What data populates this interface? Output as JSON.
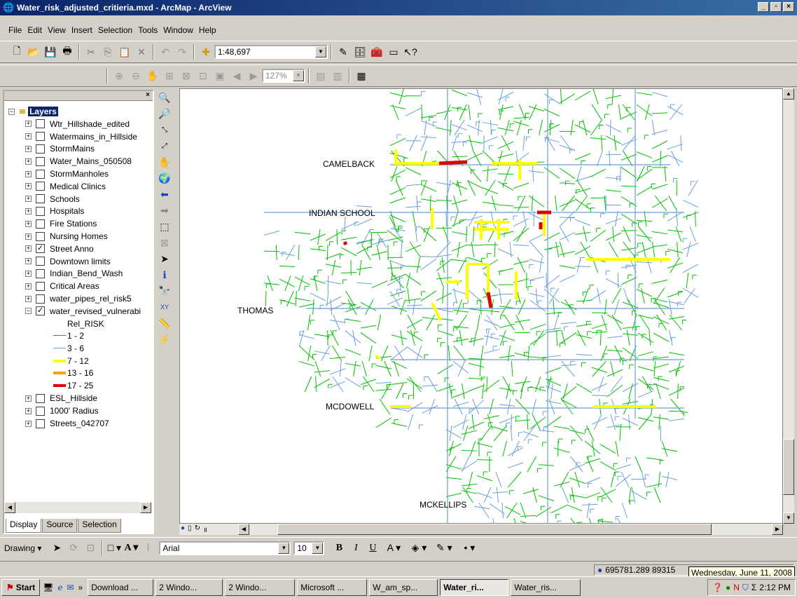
{
  "window": {
    "title": "Water_risk_adjusted_critieria.mxd - ArcMap - ArcView",
    "buttons": [
      "_",
      "▫",
      "×"
    ]
  },
  "menu": [
    "File",
    "Edit",
    "View",
    "Insert",
    "Selection",
    "Tools",
    "Window",
    "Help"
  ],
  "standard_toolbar": {
    "scale": "1:48,697"
  },
  "layout_toolbar": {
    "zoom": "127%"
  },
  "toc": {
    "root": "Layers",
    "layers": [
      {
        "name": "Wtr_Hillshade_edited",
        "checked": false
      },
      {
        "name": "Watermains_in_Hillside",
        "checked": false
      },
      {
        "name": "StormMains",
        "checked": false
      },
      {
        "name": "Water_Mains_050508",
        "checked": false
      },
      {
        "name": "StormManholes",
        "checked": false
      },
      {
        "name": "Medical Clinics",
        "checked": false
      },
      {
        "name": "Schools",
        "checked": false
      },
      {
        "name": "Hospitals",
        "checked": false
      },
      {
        "name": "Fire Stations",
        "checked": false
      },
      {
        "name": "Nursing Homes",
        "checked": false
      },
      {
        "name": "Street Anno",
        "checked": true
      },
      {
        "name": "Downtown limits",
        "checked": false
      },
      {
        "name": "Indian_Bend_Wash",
        "checked": false
      },
      {
        "name": "Critical Areas",
        "checked": false
      },
      {
        "name": "water_pipes_rel_risk5",
        "checked": false
      },
      {
        "name": "water_revised_vulnerabi",
        "checked": true,
        "expanded": true
      }
    ],
    "legend_field": "Rel_RISK",
    "legend": [
      {
        "label": "1 - 2",
        "color": "#00c000"
      },
      {
        "label": "3 - 6",
        "color": "#6a9fd8"
      },
      {
        "label": "7 - 12",
        "color": "#ffff00"
      },
      {
        "label": "13 - 16",
        "color": "#ffa500"
      },
      {
        "label": "17 - 25",
        "color": "#e00000"
      }
    ],
    "layers_after": [
      {
        "name": "ESL_Hillside",
        "checked": false
      },
      {
        "name": "1000' Radius",
        "checked": false
      },
      {
        "name": "Streets_042707",
        "checked": false
      }
    ],
    "tabs": [
      "Display",
      "Source",
      "Selection"
    ]
  },
  "map": {
    "labels": [
      "CAMELBACK",
      "INDIAN SCHOOL",
      "THOMAS",
      "MCDOWELL",
      "MCKELLIPS"
    ]
  },
  "drawing_toolbar": {
    "drawing_label": "Drawing",
    "font": "Arial",
    "font_size": "10",
    "bold": "B",
    "italic": "I",
    "underline": "U"
  },
  "status": {
    "coords": "695781.289  89315"
  },
  "tooltip": "Wednesday, June 11, 2008",
  "taskbar": {
    "start": "Start",
    "tasks": [
      {
        "label": "Download ...",
        "active": false
      },
      {
        "label": "2 Windo...",
        "active": false
      },
      {
        "label": "2 Windo...",
        "active": false
      },
      {
        "label": "Microsoft ...",
        "active": false
      },
      {
        "label": "W_am_sp...",
        "active": false
      },
      {
        "label": "Water_ri...",
        "active": true
      },
      {
        "label": "Water_ris...",
        "active": false
      }
    ],
    "clock": "2:12 PM"
  }
}
